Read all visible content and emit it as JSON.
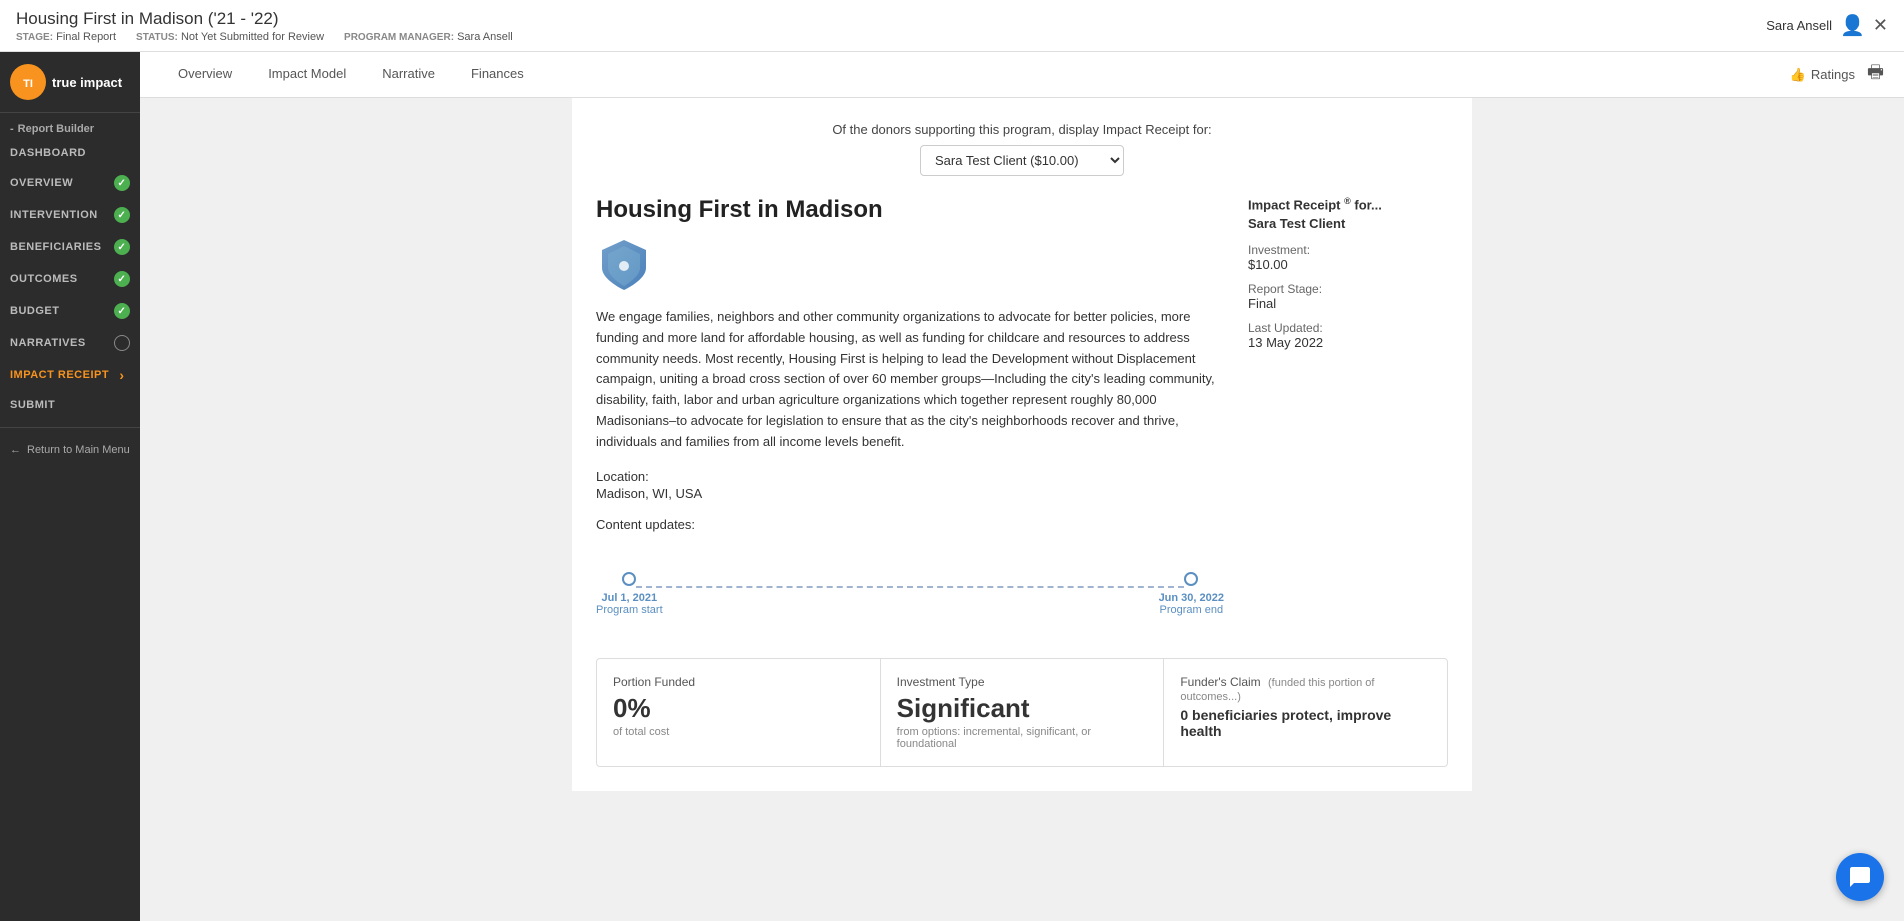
{
  "header": {
    "title": "Housing First in Madison ('21 - '22)",
    "stage_label": "STAGE:",
    "stage_value": "Final Report",
    "status_label": "STATUS:",
    "status_value": "Not Yet Submitted for Review",
    "program_manager_label": "PROGRAM MANAGER:",
    "program_manager_value": "Sara Ansell",
    "user_name": "Sara Ansell"
  },
  "sidebar": {
    "report_builder_label": "Report Builder",
    "items": [
      {
        "id": "dashboard",
        "label": "Dashboard",
        "status": "none",
        "active": false
      },
      {
        "id": "overview",
        "label": "Overview",
        "status": "complete",
        "active": false
      },
      {
        "id": "intervention",
        "label": "Intervention",
        "status": "complete",
        "active": false
      },
      {
        "id": "beneficiaries",
        "label": "Beneficiaries",
        "status": "complete",
        "active": false
      },
      {
        "id": "outcomes",
        "label": "Outcomes",
        "status": "complete",
        "active": false
      },
      {
        "id": "budget",
        "label": "Budget",
        "status": "complete",
        "active": false
      },
      {
        "id": "narratives",
        "label": "Narratives",
        "status": "empty",
        "active": false
      },
      {
        "id": "impact-receipt",
        "label": "Impact Receipt",
        "status": "arrow",
        "active": true
      },
      {
        "id": "submit",
        "label": "Submit",
        "status": "none",
        "active": false
      }
    ],
    "return_label": "Return to Main Menu"
  },
  "tabs": {
    "items": [
      {
        "id": "overview",
        "label": "Overview",
        "active": false
      },
      {
        "id": "impact-model",
        "label": "Impact Model",
        "active": false
      },
      {
        "id": "narrative",
        "label": "Narrative",
        "active": false
      },
      {
        "id": "finances",
        "label": "Finances",
        "active": false
      }
    ],
    "ratings_label": "Ratings",
    "active_tab": "impact-receipt"
  },
  "impact_receipt": {
    "donor_select_text": "Of the donors supporting this program, display Impact Receipt for:",
    "donor_selected": "Sara Test Client ($10.00)",
    "donor_options": [
      "Sara Test Client ($10.00)"
    ],
    "program_name": "Housing First in Madison",
    "program_description": "We engage families, neighbors and other community organizations to advocate for better policies, more funding and more land for affordable housing, as well as funding for childcare and resources to address community needs. Most recently, Housing First is helping to lead the Development without Displacement campaign, uniting a broad cross section of over 60 member groups—Including the city's leading community, disability, faith, labor and urban agriculture organizations which together represent roughly 80,000 Madisonians–to advocate for legislation to ensure that as the city's neighborhoods recover and thrive, individuals and families from all income levels benefit.",
    "location_label": "Location:",
    "location_value": "Madison, WI, USA",
    "content_updates_label": "Content updates:",
    "timeline": {
      "start_date": "Jul 1, 2021",
      "start_label": "Program start",
      "end_date": "Jun 30, 2022",
      "end_label": "Program end"
    },
    "receipt_panel": {
      "title": "Impact Receipt",
      "for_text": "for...",
      "client_name": "Sara Test Client",
      "investment_label": "Investment:",
      "investment_value": "$10.00",
      "report_stage_label": "Report Stage:",
      "report_stage_value": "Final",
      "last_updated_label": "Last Updated:",
      "last_updated_value": "13 May 2022"
    },
    "bottom_cards": {
      "portion_funded": {
        "label": "Portion Funded",
        "value": "0%",
        "subtext": "of total cost"
      },
      "investment_type": {
        "label": "Investment Type",
        "value": "Significant",
        "subtext": "from options: incremental, significant, or foundational"
      },
      "funders_claim": {
        "label": "Funder's Claim",
        "label_suffix": "(funded this portion of outcomes...)",
        "value": "0 beneficiaries protect, improve health"
      }
    }
  }
}
